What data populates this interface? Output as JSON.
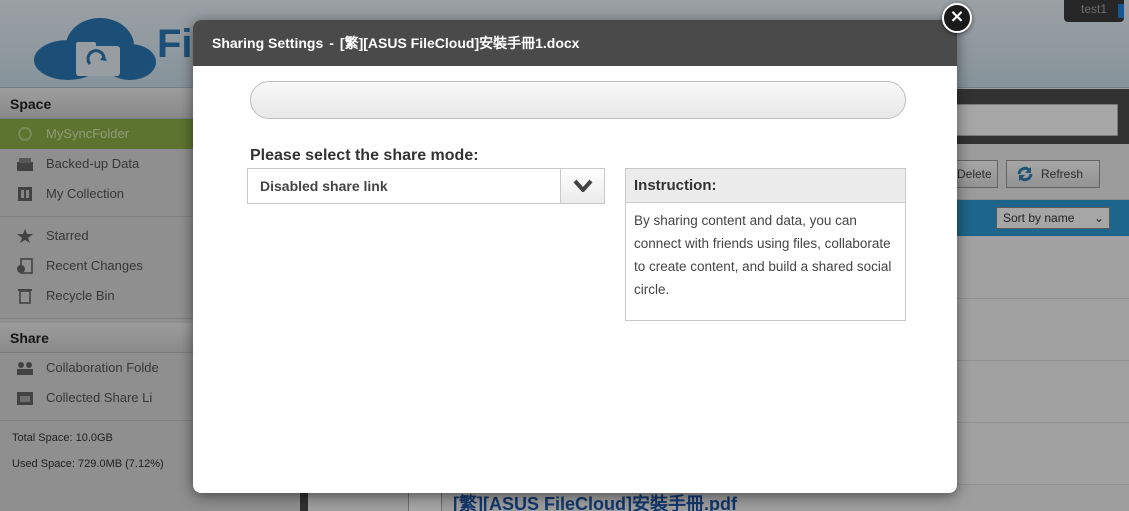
{
  "app": {
    "logo_text": "Fi",
    "user_badge": "test1",
    "sidebar": {
      "space_heading": "Space",
      "space_items": [
        {
          "label": "MySyncFolder",
          "icon": "sync-folder-icon"
        },
        {
          "label": "Backed-up Data",
          "icon": "backup-icon"
        },
        {
          "label": "My Collection",
          "icon": "collection-icon"
        }
      ],
      "misc_items": [
        {
          "label": "Starred",
          "icon": "star-icon"
        },
        {
          "label": "Recent Changes",
          "icon": "recent-changes-icon"
        },
        {
          "label": "Recycle Bin",
          "icon": "trash-icon"
        }
      ],
      "share_heading": "Share",
      "share_items": [
        {
          "label": "Collaboration Folde",
          "icon": "collaboration-icon"
        },
        {
          "label": "Collected Share Li",
          "icon": "share-link-icon"
        }
      ],
      "total_space": "Total Space: 10.0GB",
      "used_space": "Used Space: 729.0MB (7.12%)"
    },
    "toolbar": {
      "delete_label": "Delete",
      "refresh_label": "Refresh"
    },
    "sort_label": "Sort by name",
    "bottom_file": "[繁][ASUS FileCloud]安裝手冊.pdf"
  },
  "modal": {
    "title_prefix": "Sharing Settings",
    "title_separator": "-",
    "title_file": "[繁][ASUS FileCloud]安裝手冊1.docx",
    "link_value": "",
    "mode_label": "Please select the share mode:",
    "mode_selected": "Disabled share link",
    "instruction_heading": "Instruction:",
    "instruction_text": "By sharing content and data, you can connect with friends using files, collaborate to create content, and build a shared social circle.",
    "close_symbol": "×"
  },
  "colors": {
    "modal_header": "#4a4a4a",
    "sidebar_active": "#8fb24a",
    "sort_bar": "#2f9cd6",
    "overlay": "rgba(0,0,0,0.35)"
  }
}
